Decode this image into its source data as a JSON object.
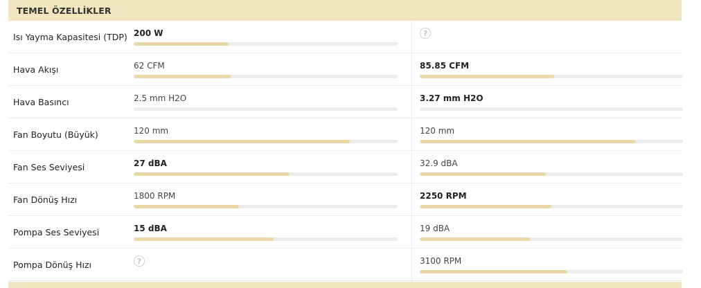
{
  "section": {
    "title": "TEMEL ÖZELLİKLER"
  },
  "colors": {
    "header_bg": "#f1e6c0",
    "bar_fill": "#ead9a8",
    "bar_track": "#ececec"
  },
  "rows": [
    {
      "label": "Isı Yayma Kapasitesi (TDP)",
      "a": {
        "text": "200 W",
        "best": true,
        "fill_pct": 36,
        "unknown": false
      },
      "b": {
        "text": "",
        "best": false,
        "fill_pct": 0,
        "unknown": true,
        "icon": "question-circle-icon",
        "icon_glyph": "?"
      }
    },
    {
      "label": "Hava Akışı",
      "a": {
        "text": "62 CFM",
        "best": false,
        "fill_pct": 37,
        "unknown": false
      },
      "b": {
        "text": "85.85 CFM",
        "best": true,
        "fill_pct": 51,
        "unknown": false
      }
    },
    {
      "label": "Hava Basıncı",
      "a": {
        "text": "2.5 mm H2O",
        "best": false,
        "fill_pct": 0,
        "unknown": false
      },
      "b": {
        "text": "3.27 mm H2O",
        "best": true,
        "fill_pct": 0,
        "unknown": false
      }
    },
    {
      "label": "Fan Boyutu (Büyük)",
      "a": {
        "text": "120 mm",
        "best": false,
        "fill_pct": 82,
        "unknown": false
      },
      "b": {
        "text": "120 mm",
        "best": false,
        "fill_pct": 82,
        "unknown": false
      }
    },
    {
      "label": "Fan Ses Seviyesi",
      "a": {
        "text": "27 dBA",
        "best": true,
        "fill_pct": 59,
        "unknown": false
      },
      "b": {
        "text": "32.9 dBA",
        "best": false,
        "fill_pct": 48,
        "unknown": false
      }
    },
    {
      "label": "Fan Dönüş Hızı",
      "a": {
        "text": "1800 RPM",
        "best": false,
        "fill_pct": 40,
        "unknown": false
      },
      "b": {
        "text": "2250 RPM",
        "best": true,
        "fill_pct": 50,
        "unknown": false
      }
    },
    {
      "label": "Pompa Ses Seviyesi",
      "a": {
        "text": "15 dBA",
        "best": true,
        "fill_pct": 53,
        "unknown": false
      },
      "b": {
        "text": "19 dBA",
        "best": false,
        "fill_pct": 42,
        "unknown": false
      }
    },
    {
      "label": "Pompa Dönüş Hızı",
      "a": {
        "text": "",
        "best": false,
        "fill_pct": 0,
        "unknown": true,
        "icon": "question-circle-icon",
        "icon_glyph": "?"
      },
      "b": {
        "text": "3100 RPM",
        "best": false,
        "fill_pct": 56,
        "unknown": false
      }
    }
  ]
}
